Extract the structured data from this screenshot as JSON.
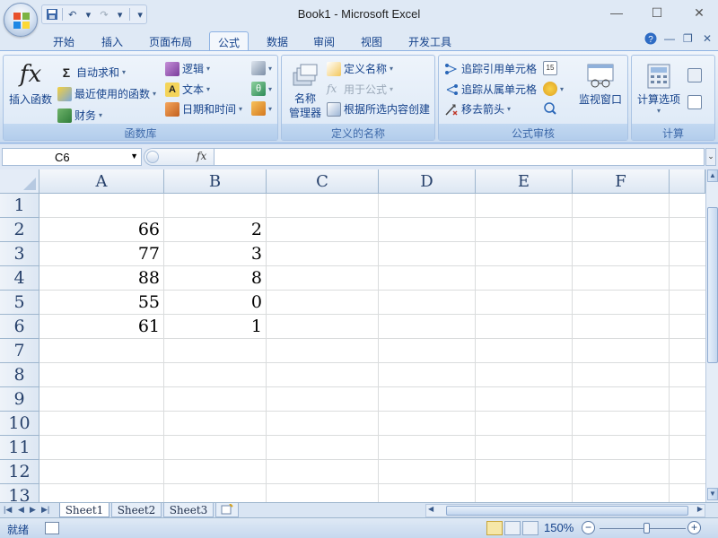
{
  "window": {
    "title": "Book1 - Microsoft Excel"
  },
  "tabs": [
    "开始",
    "插入",
    "页面布局",
    "公式",
    "数据",
    "审阅",
    "视图",
    "开发工具"
  ],
  "active_tab": "公式",
  "ribbon": {
    "function_library": {
      "label": "函数库",
      "insert_function": "插入函数",
      "autosum": "自动求和",
      "recently_used": "最近使用的函数",
      "financial": "财务",
      "logical": "逻辑",
      "text": "文本",
      "date_time": "日期和时间"
    },
    "defined_names": {
      "label": "定义的名称",
      "name_manager": "名称\n管理器",
      "define_name": "定义名称",
      "use_in_formula": "用于公式",
      "create_from_selection": "根据所选内容创建"
    },
    "formula_auditing": {
      "label": "公式审核",
      "trace_precedents": "追踪引用单元格",
      "trace_dependents": "追踪从属单元格",
      "remove_arrows": "移去箭头",
      "watch_window": "监视窗口"
    },
    "calculation": {
      "label": "计算",
      "calc_options": "计算选项"
    }
  },
  "formula_bar": {
    "name_box": "C6",
    "fx": "fx",
    "formula": ""
  },
  "sheet": {
    "columns": [
      "A",
      "B",
      "C",
      "D",
      "E",
      "F"
    ],
    "rows": [
      "1",
      "2",
      "3",
      "4",
      "5",
      "6",
      "7",
      "8",
      "9",
      "10",
      "11",
      "12",
      "13"
    ],
    "cells": [
      {
        "col": "A",
        "row": 2,
        "value": "66"
      },
      {
        "col": "B",
        "row": 2,
        "value": "2"
      },
      {
        "col": "A",
        "row": 3,
        "value": "77"
      },
      {
        "col": "B",
        "row": 3,
        "value": "3"
      },
      {
        "col": "A",
        "row": 4,
        "value": "88"
      },
      {
        "col": "B",
        "row": 4,
        "value": "8"
      },
      {
        "col": "A",
        "row": 5,
        "value": "55"
      },
      {
        "col": "B",
        "row": 5,
        "value": "0"
      },
      {
        "col": "A",
        "row": 6,
        "value": "61"
      },
      {
        "col": "B",
        "row": 6,
        "value": "1"
      }
    ]
  },
  "sheet_tabs": [
    "Sheet1",
    "Sheet2",
    "Sheet3"
  ],
  "active_sheet": "Sheet1",
  "status": {
    "text": "就绪",
    "zoom": "150%",
    "zoom_fraction": 0.55
  }
}
